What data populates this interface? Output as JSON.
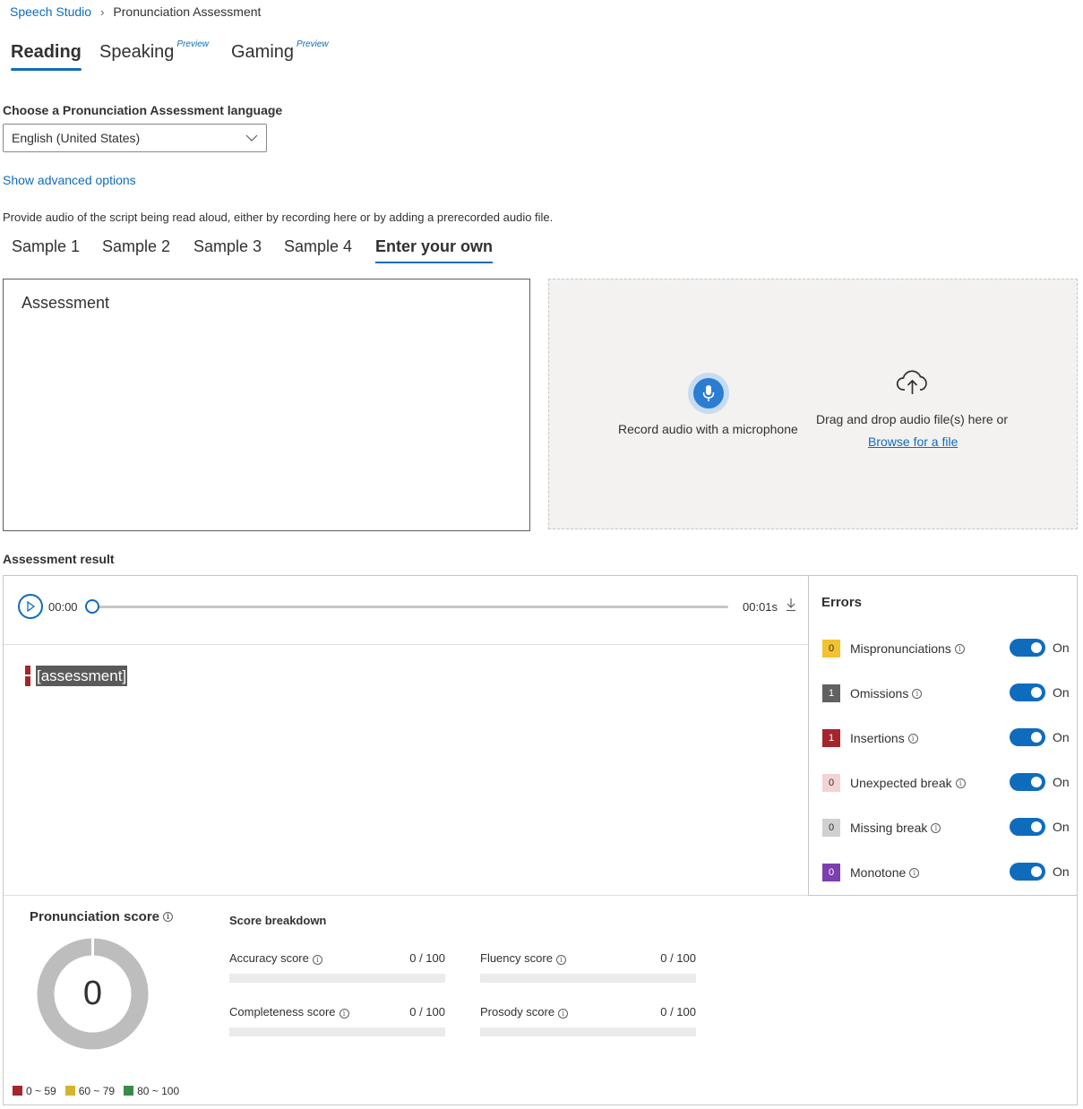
{
  "breadcrumb": {
    "root": "Speech Studio",
    "current": "Pronunciation Assessment"
  },
  "main_tabs": [
    {
      "label": "Reading",
      "badge": ""
    },
    {
      "label": "Speaking",
      "badge": "Preview"
    },
    {
      "label": "Gaming",
      "badge": "Preview"
    }
  ],
  "language": {
    "label": "Choose a Pronunciation Assessment language",
    "selected": "English (United States)"
  },
  "advanced_link": "Show advanced options",
  "provide_text": "Provide audio of the script being read aloud, either by recording here or by adding a prerecorded audio file.",
  "sample_tabs": [
    "Sample 1",
    "Sample 2",
    "Sample 3",
    "Sample 4",
    "Enter your own"
  ],
  "script_text": "Assessment",
  "drop_zone": {
    "mic_label": "Record audio with a microphone",
    "drag_text": "Drag and drop audio file(s) here or",
    "browse_link": "Browse for a file"
  },
  "result": {
    "label": "Assessment result",
    "time_start": "00:00",
    "time_end": "00:01s",
    "word": "[assessment]",
    "playback_progress": 0
  },
  "errors": {
    "title": "Errors",
    "items": [
      {
        "count": "0",
        "label": "Mispronunciations",
        "state": "On",
        "color": "#f2c230",
        "text_color": "#323130"
      },
      {
        "count": "1",
        "label": "Omissions",
        "state": "On",
        "color": "#616161",
        "text_color": "#ffffff"
      },
      {
        "count": "1",
        "label": "Insertions",
        "state": "On",
        "color": "#a4262c",
        "text_color": "#ffffff"
      },
      {
        "count": "0",
        "label": "Unexpected break",
        "state": "On",
        "color": "#f4d3d6",
        "text_color": "#323130"
      },
      {
        "count": "0",
        "label": "Missing break",
        "state": "On",
        "color": "#d2d0ce",
        "text_color": "#323130"
      },
      {
        "count": "0",
        "label": "Monotone",
        "state": "On",
        "color": "#7b3fb0",
        "text_color": "#ffffff"
      }
    ]
  },
  "pronunciation": {
    "title": "Pronunciation score",
    "score": "0",
    "legend": [
      {
        "range": "0 ~ 59",
        "color": "#a4262c"
      },
      {
        "range": "60 ~ 79",
        "color": "#d4b42f"
      },
      {
        "range": "80 ~ 100",
        "color": "#3c8a4a"
      }
    ]
  },
  "breakdown": {
    "title": "Score breakdown",
    "items": [
      {
        "label": "Accuracy score",
        "value": "0 / 100",
        "progress": 0
      },
      {
        "label": "Fluency score",
        "value": "0 / 100",
        "progress": 0
      },
      {
        "label": "Completeness score",
        "value": "0 / 100",
        "progress": 0
      },
      {
        "label": "Prosody score",
        "value": "0 / 100",
        "progress": 0
      }
    ]
  },
  "colors": {
    "accent": "#0f6cbd",
    "donut_track": "#bdbdbd"
  }
}
